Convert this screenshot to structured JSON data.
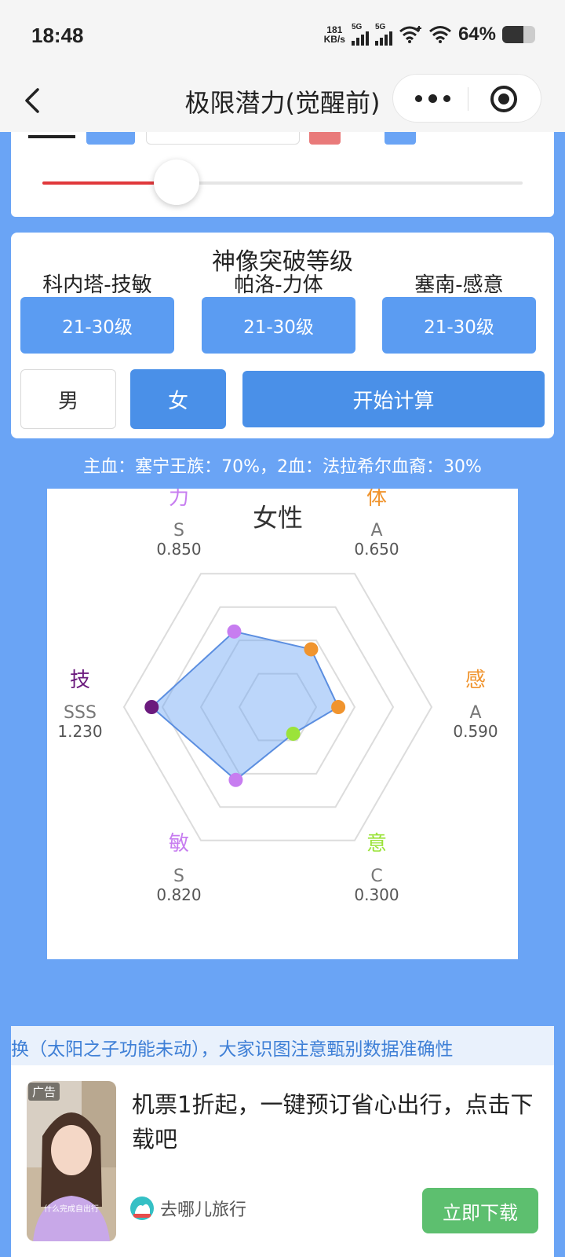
{
  "status_bar": {
    "time": "18:48",
    "net_speed_value": "181",
    "net_speed_unit": "KB/s",
    "sim1": "5G",
    "sim2": "5G",
    "battery_text": "64%",
    "battery_level": 0.64,
    "icons": [
      "signal-icon",
      "wifi-plus-icon",
      "wifi-icon",
      "battery-icon"
    ]
  },
  "nav": {
    "title": "极限潜力(觉醒前)",
    "icons": [
      "back-icon",
      "more-icon",
      "target-icon"
    ]
  },
  "slider": {
    "value_fraction": 0.28
  },
  "breakthrough": {
    "title": "神像突破等级",
    "columns": [
      {
        "name": "科内塔-技敏",
        "level": "21-30级"
      },
      {
        "name": "帕洛-力体",
        "level": "21-30级"
      },
      {
        "name": "塞南-感意",
        "level": "21-30级"
      }
    ],
    "gender_male": "男",
    "gender_female": "女",
    "selected_gender": "女",
    "calc_button": "开始计算"
  },
  "blood_info": "主血：塞宁王族：70%，2血：法拉希尔血裔：30%",
  "notice_text": "换（太阳之子功能未动），大家识图注意甄别数据准确性",
  "ad": {
    "tag": "广告",
    "thumb_caption": "什么完成自出行",
    "text": "机票1折起，一键预订省心出行，点击下载吧",
    "brand": "去哪儿旅行",
    "button": "立即下载"
  },
  "colors": {
    "page_bg": "#6aa4f5",
    "primary_button": "#4a90e8",
    "level_button": "#5b9cf2",
    "slider_fill": "#e0383b",
    "download_button": "#5dbf6f",
    "notice_text": "#3e7fd6"
  },
  "chart_data": {
    "type": "radar",
    "title": "女性",
    "axes": [
      {
        "label": "力",
        "grade": "S",
        "value": 0.85,
        "value_text": "0.850",
        "color": "#c77df0"
      },
      {
        "label": "体",
        "grade": "A",
        "value": 0.65,
        "value_text": "0.650",
        "color": "#f0942e"
      },
      {
        "label": "感",
        "grade": "A",
        "value": 0.59,
        "value_text": "0.590",
        "color": "#f0942e"
      },
      {
        "label": "意",
        "grade": "C",
        "value": 0.3,
        "value_text": "0.300",
        "color": "#9be33a"
      },
      {
        "label": "敏",
        "grade": "S",
        "value": 0.82,
        "value_text": "0.820",
        "color": "#c77df0"
      },
      {
        "label": "技",
        "grade": "SSS",
        "value": 1.23,
        "value_text": "1.230",
        "color": "#6b1a7d"
      }
    ],
    "rmax": 1.5,
    "rings": 4,
    "fill_color": "#6aa4f5",
    "line_color": "#5b8ee0",
    "grid": true
  }
}
